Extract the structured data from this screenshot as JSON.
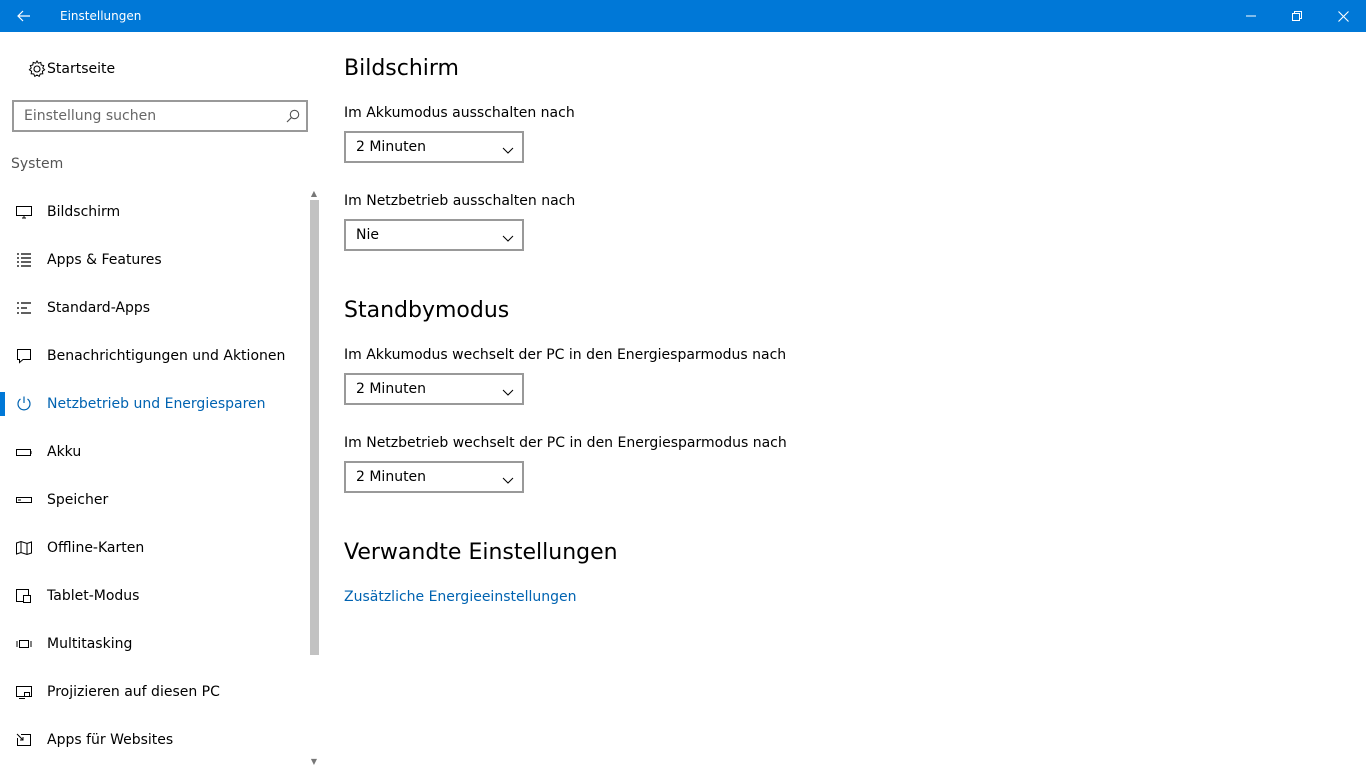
{
  "window": {
    "title": "Einstellungen",
    "accent": "#0078d7"
  },
  "sidebar": {
    "home_label": "Startseite",
    "search_placeholder": "Einstellung suchen",
    "section": "System",
    "items": [
      {
        "label": "Bildschirm",
        "icon": "monitor-icon"
      },
      {
        "label": "Apps & Features",
        "icon": "apps-list-icon"
      },
      {
        "label": "Standard-Apps",
        "icon": "default-apps-icon"
      },
      {
        "label": "Benachrichtigungen und Aktionen",
        "icon": "notification-icon"
      },
      {
        "label": "Netzbetrieb und Energiesparen",
        "icon": "power-icon",
        "active": true
      },
      {
        "label": "Akku",
        "icon": "battery-icon"
      },
      {
        "label": "Speicher",
        "icon": "storage-icon"
      },
      {
        "label": "Offline-Karten",
        "icon": "map-icon"
      },
      {
        "label": "Tablet-Modus",
        "icon": "tablet-mode-icon"
      },
      {
        "label": "Multitasking",
        "icon": "multitasking-icon"
      },
      {
        "label": "Projizieren auf diesen PC",
        "icon": "project-icon"
      },
      {
        "label": "Apps für Websites",
        "icon": "apps-websites-icon"
      }
    ]
  },
  "main": {
    "screen": {
      "heading": "Bildschirm",
      "battery_label": "Im Akkumodus ausschalten nach",
      "battery_value": "2 Minuten",
      "plugged_label": "Im Netzbetrieb ausschalten nach",
      "plugged_value": "Nie"
    },
    "sleep": {
      "heading": "Standbymodus",
      "battery_label": "Im Akkumodus wechselt der PC in den Energiesparmodus nach",
      "battery_value": "2 Minuten",
      "plugged_label": "Im Netzbetrieb wechselt der PC in den Energiesparmodus nach",
      "plugged_value": "2 Minuten"
    },
    "related": {
      "heading": "Verwandte Einstellungen",
      "link": "Zusätzliche Energieeinstellungen"
    }
  }
}
